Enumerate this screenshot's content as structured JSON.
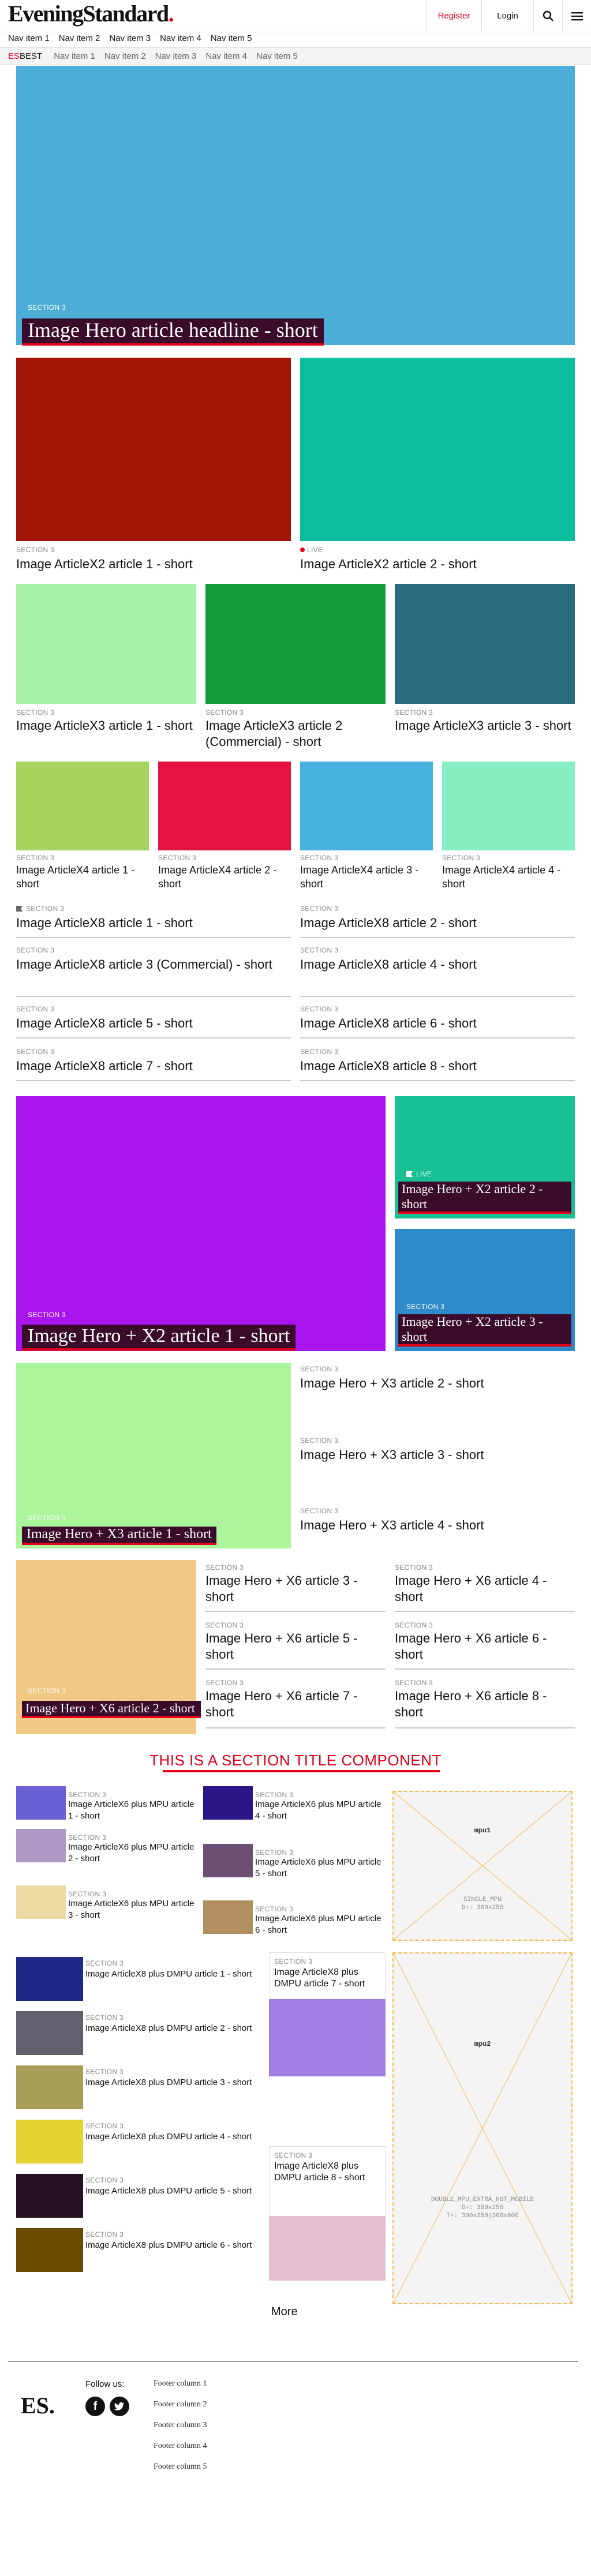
{
  "header": {
    "logo_main": "EveningStandard",
    "logo_dot": ".",
    "register": "Register",
    "login": "Login"
  },
  "nav": {
    "primary": [
      "Nav item 1",
      "Nav item 2",
      "Nav item 3",
      "Nav item 4",
      "Nav item 5"
    ],
    "es": "ES",
    "best": "BEST",
    "secondary": [
      "Nav item 1",
      "Nav item 2",
      "Nav item 3",
      "Nav item 4",
      "Nav item 5"
    ]
  },
  "hero": {
    "section": "SECTION 3",
    "title": "Image Hero article headline - short"
  },
  "x2": [
    {
      "section": "SECTION 3",
      "title": "Image ArticleX2 article 1 - short"
    },
    {
      "section": "LIVE",
      "title": "Image ArticleX2 article 2 - short"
    }
  ],
  "x3": [
    {
      "section": "SECTION 3",
      "title": "Image ArticleX3 article 1 - short"
    },
    {
      "section": "SECTION 3",
      "title": "Image ArticleX3 article 2 (Commercial) - short"
    },
    {
      "section": "SECTION 3",
      "title": "Image ArticleX3 article 3 - short"
    }
  ],
  "x4": [
    {
      "section": "SECTION 3",
      "title": "Image ArticleX4 article 1 - short"
    },
    {
      "section": "SECTION 3",
      "title": "Image ArticleX4 article 2 - short"
    },
    {
      "section": "SECTION 3",
      "title": "Image ArticleX4 article 3 - short"
    },
    {
      "section": "SECTION 3",
      "title": "Image ArticleX4 article 4 - short"
    }
  ],
  "x8": [
    {
      "section": "SECTION 3",
      "title": "Image ArticleX8 article 1 - short"
    },
    {
      "section": "SECTION 3",
      "title": "Image ArticleX8 article 2 - short"
    },
    {
      "section": "SECTION 3",
      "title": "Image ArticleX8 article 3 (Commercial) - short"
    },
    {
      "section": "SECTION 3",
      "title": "Image ArticleX8 article 4 - short"
    },
    {
      "section": "SECTION 3",
      "title": "Image ArticleX8 article 5 - short"
    },
    {
      "section": "SECTION 3",
      "title": "Image ArticleX8 article 6 - short"
    },
    {
      "section": "SECTION 3",
      "title": "Image ArticleX8 article 7 - short"
    },
    {
      "section": "SECTION 3",
      "title": "Image ArticleX8 article 8 - short"
    }
  ],
  "hx2": [
    {
      "section": "SECTION 3",
      "title": "Image Hero + X2 article 1 - short"
    },
    {
      "section": "LIVE",
      "title": "Image Hero + X2 article 2 - short"
    },
    {
      "section": "SECTION 3",
      "title": "Image Hero + X2 article 3 - short"
    }
  ],
  "hx3": [
    {
      "section": "SECTION 3",
      "title": "Image Hero + X3 article 1 - short"
    },
    {
      "section": "SECTION 3",
      "title": "Image Hero + X3 article 2 - short"
    },
    {
      "section": "SECTION 3",
      "title": "Image Hero + X3 article 3 - short"
    },
    {
      "section": "SECTION 3",
      "title": "Image Hero + X3 article 4 - short"
    }
  ],
  "hx6": [
    {
      "section": "SECTION 3",
      "title": "Image Hero + X6 article 2 - short"
    },
    {
      "section": "SECTION 3",
      "title": "Image Hero + X6 article 3 - short"
    },
    {
      "section": "SECTION 3",
      "title": "Image Hero + X6 article 4 - short"
    },
    {
      "section": "SECTION 3",
      "title": "Image Hero + X6 article 5 - short"
    },
    {
      "section": "SECTION 3",
      "title": "Image Hero + X6 article 6 - short"
    },
    {
      "section": "SECTION 3",
      "title": "Image Hero + X6 article 7 - short"
    },
    {
      "section": "SECTION 3",
      "title": "Image Hero + X6 article 8 - short"
    }
  ],
  "section_title": "THIS IS A SECTION TITLE COMPONENT",
  "mpu_list": [
    {
      "section": "SECTION 3",
      "title": "Image ArticleX6 plus MPU article 1 - short"
    },
    {
      "section": "SECTION 3",
      "title": "Image ArticleX6 plus MPU article 2 - short"
    },
    {
      "section": "SECTION 3",
      "title": "Image ArticleX6 plus MPU article 3 - short"
    },
    {
      "section": "SECTION 3",
      "title": "Image ArticleX6 plus MPU article 4 - short"
    },
    {
      "section": "SECTION 3",
      "title": "Image ArticleX6 plus MPU article 5 - short"
    },
    {
      "section": "SECTION 3",
      "title": "Image ArticleX6 plus MPU article 6 - short"
    }
  ],
  "mpu_ad": {
    "label": "mpu1",
    "info1": "SINGLE_MPU",
    "info2": "D+: 300x250"
  },
  "dmpu_list": [
    {
      "section": "SECTION 3",
      "title": "Image ArticleX8 plus DMPU article 1 - short"
    },
    {
      "section": "SECTION 3",
      "title": "Image ArticleX8 plus DMPU article 2 - short"
    },
    {
      "section": "SECTION 3",
      "title": "Image ArticleX8 plus DMPU article 3 - short"
    },
    {
      "section": "SECTION 3",
      "title": "Image ArticleX8 plus DMPU article 4 - short"
    },
    {
      "section": "SECTION 3",
      "title": "Image ArticleX8 plus DMPU article 5 - short"
    },
    {
      "section": "SECTION 3",
      "title": "Image ArticleX8 plus DMPU article 6 - short"
    }
  ],
  "dmpu_cards": [
    {
      "section": "SECTION 3",
      "title": "Image ArticleX8 plus DMPU article 7 - short"
    },
    {
      "section": "SECTION 3",
      "title": "Image ArticleX8 plus DMPU article 8 - short"
    }
  ],
  "dmpu_ad": {
    "label": "mpu2",
    "info1": "DOUBLE_MPU_EXTRA_HOT_MOBILE",
    "info2": "D+: 300x250",
    "info3": "T+: 300x250|300x600"
  },
  "more": "More",
  "footer": {
    "logo": "ES.",
    "follow": "Follow us:",
    "columns": [
      "Footer column 1",
      "Footer column 2",
      "Footer column 3",
      "Footer column 4",
      "Footer column 5"
    ]
  },
  "colors": {
    "brand": "#e2001a",
    "hero": "#4cadd8"
  }
}
